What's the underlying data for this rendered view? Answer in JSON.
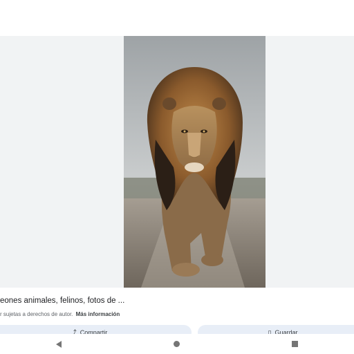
{
  "result": {
    "title": "eones animales, felinos, fotos de ...",
    "notice": "r sujetas a derechos de autor.",
    "more_info": "Más información"
  },
  "actions": {
    "share_label": "Compartir",
    "share_icon": "share-icon",
    "save_label": "Guardar",
    "save_icon": "bookmark-icon"
  },
  "navbar": {
    "back_icon": "back-triangle-icon",
    "home_icon": "home-circle-icon",
    "recents_icon": "recents-square-icon"
  },
  "colors": {
    "viewer_bg": "#f1f3f4",
    "button_bg": "#e8eef7",
    "text": "#202124"
  }
}
